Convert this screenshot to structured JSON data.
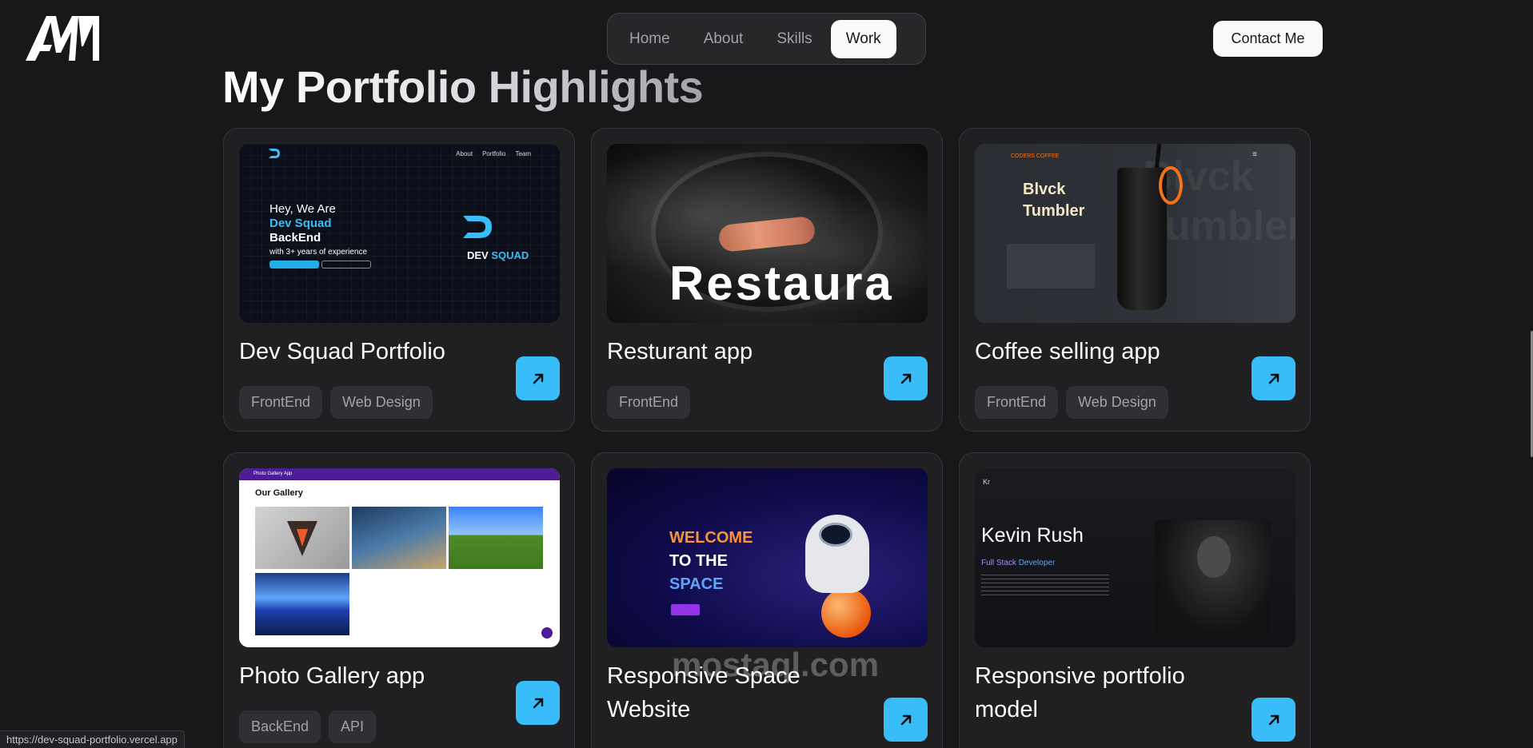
{
  "header": {
    "logo_text": "AM",
    "nav": [
      {
        "label": "Home",
        "active": false
      },
      {
        "label": "About",
        "active": false
      },
      {
        "label": "Skills",
        "active": false
      },
      {
        "label": "Work",
        "active": true
      }
    ],
    "contact_label": "Contact Me"
  },
  "section": {
    "title": "My Portfolio Highlights"
  },
  "projects": [
    {
      "title": "Dev Squad Portfolio",
      "tags": [
        "FrontEnd",
        "Web Design"
      ]
    },
    {
      "title": "Resturant app",
      "tags": [
        "FrontEnd"
      ]
    },
    {
      "title": "Coffee selling app",
      "tags": [
        "FrontEnd",
        "Web Design"
      ]
    },
    {
      "title": "Photo Gallery app",
      "tags": [
        "BackEnd",
        "API"
      ]
    },
    {
      "title": "Responsive Space Website",
      "tags": []
    },
    {
      "title": "Responsive portfolio model",
      "tags": []
    }
  ],
  "thumbnails": {
    "devsquad": {
      "nav": [
        "About",
        "Portfolio",
        "Team"
      ],
      "line1": "Hey, We Are",
      "line2": "Dev Squad",
      "line3": "BackEnd",
      "line4": "with 3+ years of experience",
      "mark_a": "DEV",
      "mark_b": "SQUAD"
    },
    "restaurant": {
      "word": "Restaura"
    },
    "coffee": {
      "brand": "CODERS COFFEE",
      "title_1": "Blvck",
      "title_2": "Tumbler",
      "ghost": "Blvck Tumbler"
    },
    "gallery": {
      "bar": "Photo Gallery App",
      "title": "Our Gallery"
    },
    "space": {
      "line1": "WELCOME",
      "line2": "TO THE",
      "line3": "SPACE"
    },
    "kevin": {
      "logo": "Kr",
      "name": "Kevin Rush",
      "role_a": "Full Stack",
      "role_b": "Developer"
    }
  },
  "status_bar": {
    "url": "https://dev-squad-portfolio.vercel.app"
  },
  "watermark": "mostaql.com",
  "colors": {
    "accent": "#38bdf8",
    "background": "#18181b",
    "card": "#202023"
  }
}
